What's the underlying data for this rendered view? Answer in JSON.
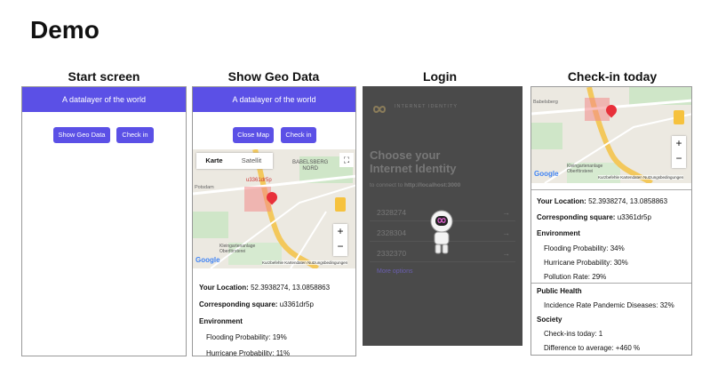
{
  "title": "Demo",
  "panels": {
    "start": {
      "title": "Start screen",
      "header": "A datalayer of the world",
      "buttons": {
        "geo": "Show Geo Data",
        "checkin": "Check in"
      }
    },
    "geo": {
      "title": "Show Geo Data",
      "header": "A datalayer of the world",
      "buttons": {
        "close": "Close Map",
        "checkin": "Check in"
      },
      "map": {
        "tab_map": "Karte",
        "tab_sat": "Satellit",
        "district": "BABELSBERG",
        "district2": "NORD",
        "marker_label": "u3361dr5p",
        "area_left": "Potsdam",
        "area_bottom": "Kleingartenanlage Oberförsterei",
        "google": "Google",
        "footer": "Kurzbefehle  Kartendaten  Nutzungsbedingungen"
      },
      "location_label": "Your Location:",
      "location_value": "52.3938274, 13.0858863",
      "square_label": "Corresponding square:",
      "square_value": "u3361dr5p",
      "env_label": "Environment",
      "flood": "Flooding Probability: 19%",
      "hurricane": "Hurricane Probability: 11%"
    },
    "login": {
      "title": "Login",
      "brand": "INTERNET IDENTITY",
      "heading1": "Choose your",
      "heading2": "Internet Identity",
      "connect_prefix": "to connect to ",
      "connect_url": "http://localhost:3000",
      "anchors": [
        "2328274",
        "2328304",
        "2332370"
      ],
      "more": "More options"
    },
    "checkin": {
      "title": "Check-in today",
      "map": {
        "area_top": "Babelsberg",
        "area_bottom": "Kleingartenanlage Oberförsterei",
        "google": "Google",
        "footer": "Kurzbefehle  Kartendaten  Nutzungsbedingungen"
      },
      "location_label": "Your Location:",
      "location_value": "52.3938274, 13.0858863",
      "square_label": "Corresponding square:",
      "square_value": "u3361dr5p",
      "env_label": "Environment",
      "flood": "Flooding Probability: 34%",
      "hurricane": "Hurricane Probability: 30%",
      "pollution": "Pollution Rate: 29%",
      "health_label": "Public Health",
      "disease": "Incidence Rate Pandemic Diseases: 32%",
      "society_label": "Society",
      "checkins": "Check-ins today: 1",
      "difference": "Difference to average: +460 %"
    }
  },
  "colors": {
    "accent": "#5b50e6",
    "login_bg": "#4a4a4a",
    "marker": "#e8303a"
  }
}
